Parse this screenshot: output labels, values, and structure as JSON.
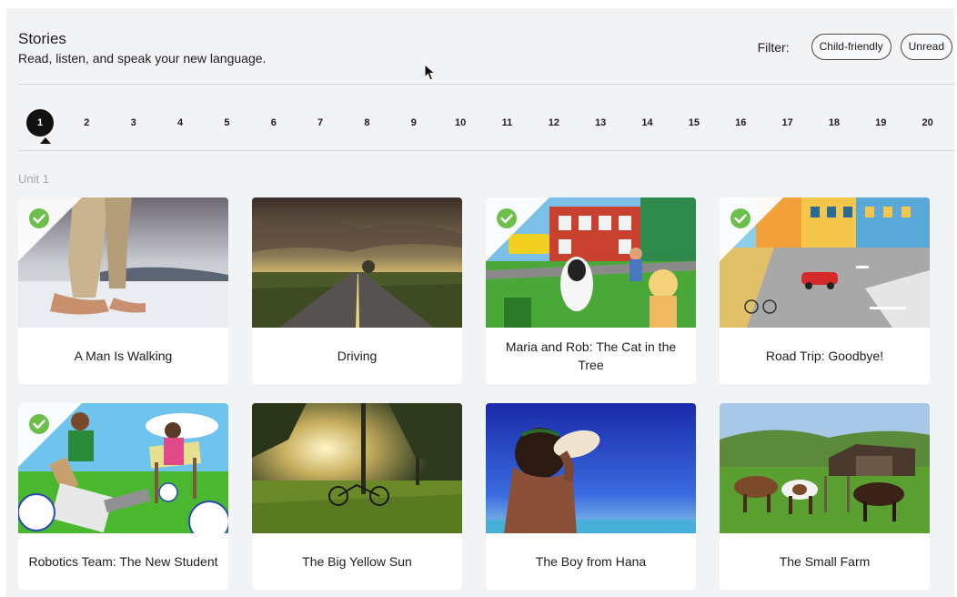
{
  "header": {
    "title": "Stories",
    "subtitle": "Read, listen, and speak your new language."
  },
  "filter": {
    "label": "Filter:",
    "chips": [
      "Child-friendly",
      "Unread"
    ]
  },
  "pagination": {
    "pages": [
      "1",
      "2",
      "3",
      "4",
      "5",
      "6",
      "7",
      "8",
      "9",
      "10",
      "11",
      "12",
      "13",
      "14",
      "15",
      "16",
      "17",
      "18",
      "19",
      "20"
    ],
    "active": "1"
  },
  "unit": {
    "label": "Unit 1"
  },
  "stories": [
    {
      "title": "A Man Is Walking",
      "completed": true,
      "image": "feet-walking-on-sand"
    },
    {
      "title": "Driving",
      "completed": false,
      "image": "road-at-sunset"
    },
    {
      "title": "Maria and Rob: The Cat in the Tree",
      "completed": true,
      "image": "cartoon-street-scene"
    },
    {
      "title": "Road Trip: Goodbye!",
      "completed": true,
      "image": "cartoon-town-intersection"
    },
    {
      "title": "Robotics Team: The New Student",
      "completed": true,
      "image": "cartoon-robotics-club"
    },
    {
      "title": "The Big Yellow Sun",
      "completed": false,
      "image": "park-with-bicycle"
    },
    {
      "title": "The Boy from Hana",
      "completed": false,
      "image": "boy-blowing-conch-shell"
    },
    {
      "title": "The Small Farm",
      "completed": false,
      "image": "cows-on-farm"
    }
  ],
  "colors": {
    "check": "#6cc04a",
    "active_page": "#111111",
    "panel": "#f2f3f5"
  }
}
